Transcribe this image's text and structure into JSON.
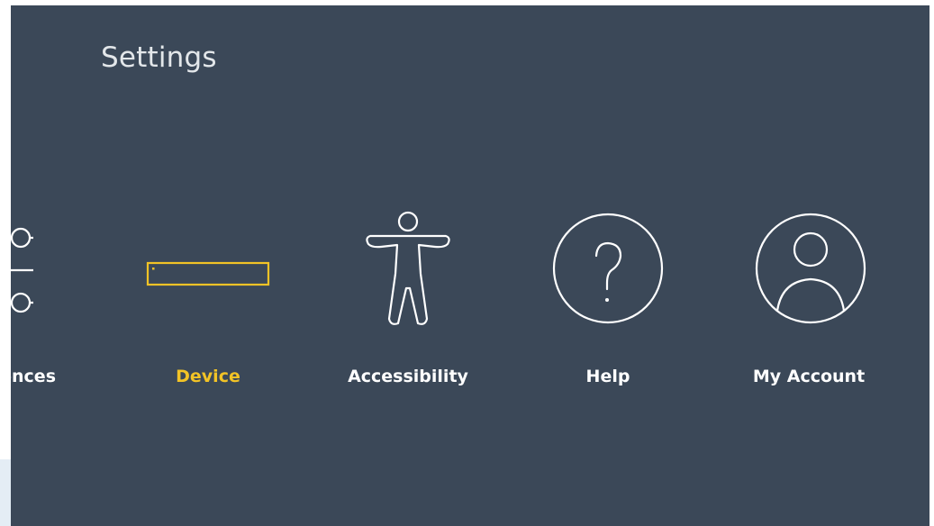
{
  "header": {
    "title": "Settings"
  },
  "menu": {
    "items": [
      {
        "id": "preferences",
        "label": "Preferences",
        "icon": "sliders-icon",
        "active": false
      },
      {
        "id": "device",
        "label": "Device",
        "icon": "fire-tv-device-icon",
        "active": true
      },
      {
        "id": "accessibility",
        "label": "Accessibility",
        "icon": "accessibility-person-icon",
        "active": false
      },
      {
        "id": "help",
        "label": "Help",
        "icon": "help-question-icon",
        "active": false
      },
      {
        "id": "account",
        "label": "My Account",
        "icon": "account-user-icon",
        "active": false
      }
    ]
  },
  "colors": {
    "background": "#3b4858",
    "text": "#ffffff",
    "title": "#e3e7ea",
    "accent": "#f2c326"
  }
}
